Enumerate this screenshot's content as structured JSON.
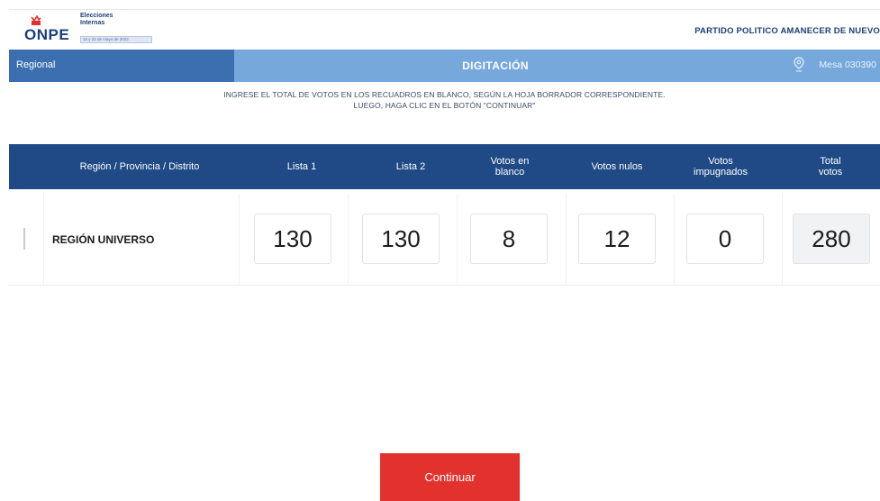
{
  "header": {
    "logo_text": "ONPE",
    "election_title": [
      "Elecciones",
      "Internas"
    ],
    "election_dates": "15 y 22 de mayo de 2022",
    "party_name": "PARTIDO POLITICO AMANECER DE NUEVO"
  },
  "bar": {
    "left_label": "Regional",
    "title": "DIGITACIÓN",
    "mesa": "Mesa 030390",
    "colors": {
      "left": "#3b6fb0",
      "right": "#76a8dc"
    }
  },
  "instructions": [
    "INGRESE EL TOTAL DE VOTOS EN LOS RECUADROS EN BLANCO, SEGÚN LA HOJA BORRADOR CORRESPONDIENTE.",
    "LUEGO, HAGA CLIC EN EL BOTÓN \"CONTINUAR\""
  ],
  "table": {
    "headers": {
      "region": "Región / Provincia / Distrito",
      "lista1": "Lista 1",
      "lista2": "Lista 2",
      "blanco": [
        "Votos en",
        "blanco"
      ],
      "nulos": "Votos nulos",
      "impugnados": [
        "Votos",
        "impugnados"
      ],
      "total": [
        "Total",
        "votos"
      ]
    },
    "rows": [
      {
        "index": "1",
        "region": "REGIÓN UNIVERSO",
        "lista1": "130",
        "lista2": "130",
        "blanco": "8",
        "nulos": "12",
        "impugnados": "0",
        "total": "280"
      }
    ]
  },
  "button": {
    "label": "Continuar",
    "color": "#e3322d"
  }
}
